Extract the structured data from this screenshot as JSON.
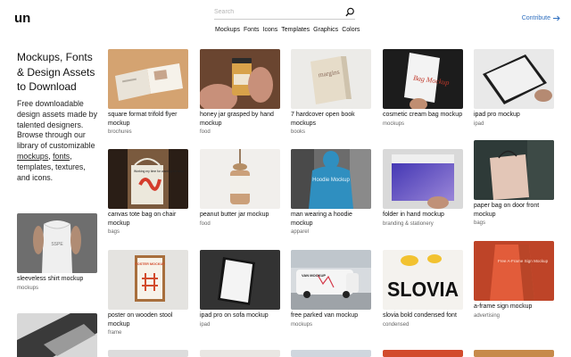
{
  "header": {
    "logo_text": "un",
    "search": {
      "placeholder": "Search",
      "value": ""
    },
    "nav": [
      "Mockups",
      "Fonts",
      "Icons",
      "Templates",
      "Graphics",
      "Colors"
    ],
    "contribute_label": "Contribute"
  },
  "hero": {
    "title": "Mockups, Fonts & Design Assets to Download",
    "desc_before": "Free downloadable design assets made by talented designers. Browse through our library of customizable ",
    "link_mockups": "mockups",
    "comma": ", ",
    "link_fonts": "fonts",
    "desc_after": ", templates, textures, and icons."
  },
  "side_items": [
    {
      "title": "sleeveless shirt mockup",
      "category": "mockups"
    }
  ],
  "cards": [
    {
      "title": "square format trifold flyer mockup",
      "category": "brochures"
    },
    {
      "title": "honey jar grasped by hand mockup",
      "category": "food"
    },
    {
      "title": "7 hardcover open book mockups",
      "category": "books"
    },
    {
      "title": "cosmetic cream bag mockup",
      "category": "mockups"
    },
    {
      "title": "ipad pro mockup",
      "category": "ipad"
    },
    {
      "title": "canvas tote bag on chair mockup",
      "category": "bags"
    },
    {
      "title": "peanut butter jar mockup",
      "category": "food"
    },
    {
      "title": "man wearing a hoodie mockup",
      "category": "apparel"
    },
    {
      "title": "folder in hand mockup",
      "category": "branding & stationery"
    },
    {
      "title": "paper bag on door front mockup",
      "category": "bags"
    },
    {
      "title": "poster on wooden stool mockup",
      "category": "frame"
    },
    {
      "title": "ipad pro on sofa mockup",
      "category": "ipad"
    },
    {
      "title": "free parked van mockup",
      "category": "mockups"
    },
    {
      "title": "slovia bold condensed font",
      "category": "condensed"
    },
    {
      "title": "a-frame sign mockup",
      "category": "advertising"
    }
  ],
  "image_text": {
    "book": "margins",
    "bag": "Bag Mockup",
    "tote": "Working my time for wanting the best.",
    "hoodie": "Hoodie Mockup",
    "poster": "POSTER MOCKUP",
    "van": "VAN MOCKUP",
    "slovia": "SLOVIA",
    "aframe": "Free A-Frame Sign Mockup",
    "shirt": "SSPE"
  },
  "colors": {
    "accent": "#2f6fbf"
  }
}
